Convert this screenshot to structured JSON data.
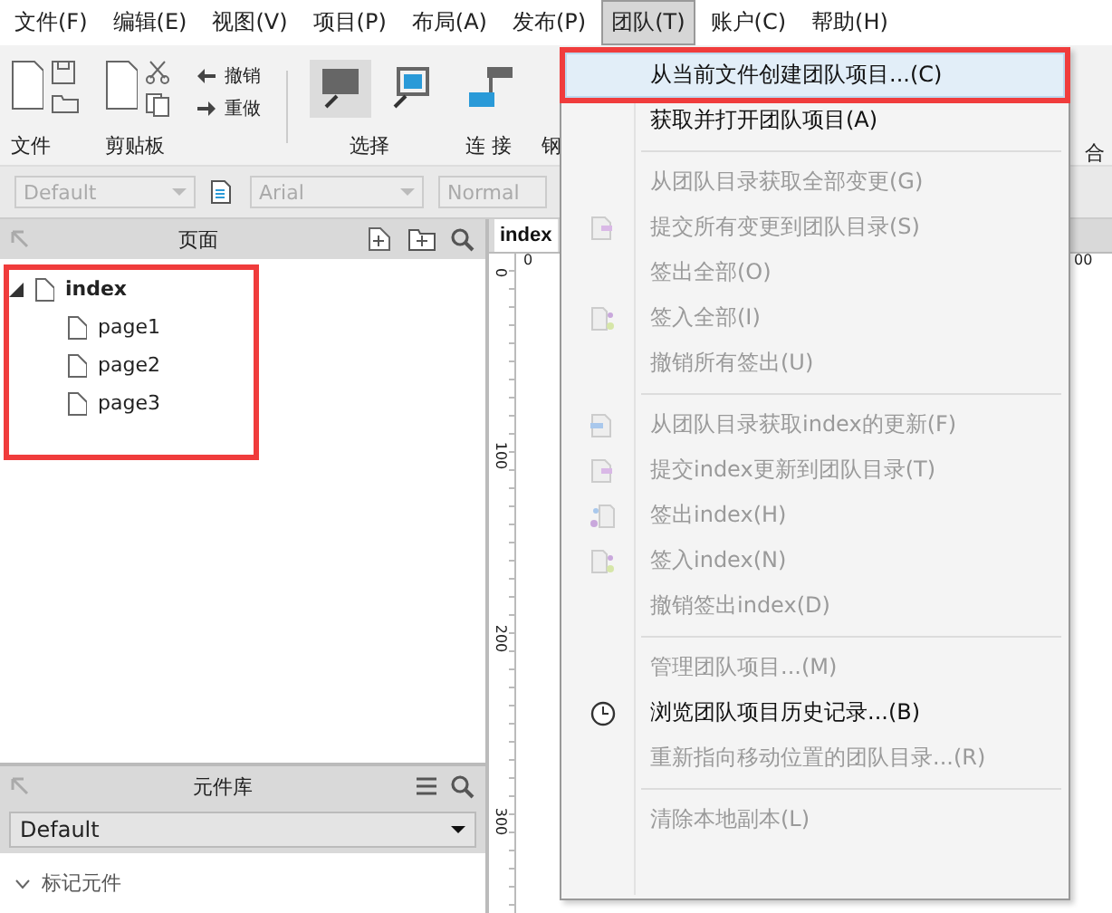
{
  "menubar": [
    {
      "label": "文件(F)",
      "selected": false
    },
    {
      "label": "编辑(E)",
      "selected": false
    },
    {
      "label": "视图(V)",
      "selected": false
    },
    {
      "label": "项目(P)",
      "selected": false
    },
    {
      "label": "布局(A)",
      "selected": false
    },
    {
      "label": "发布(P)",
      "selected": false
    },
    {
      "label": "团队(T)",
      "selected": true
    },
    {
      "label": "账户(C)",
      "selected": false
    },
    {
      "label": "帮助(H)",
      "selected": false
    }
  ],
  "toolbar": {
    "groups": [
      {
        "kind": "file",
        "label": "文件"
      },
      {
        "kind": "clipboard",
        "label": "剪贴板"
      },
      {
        "kind": "undo",
        "undo": "撤销",
        "redo": "重做"
      },
      {
        "kind": "select",
        "label": "选择"
      },
      {
        "kind": "connect",
        "label": "连 接"
      },
      {
        "kind": "pen",
        "label": "钢"
      }
    ],
    "right_label": "合"
  },
  "format_bar": {
    "style": "Default",
    "font": "Arial",
    "weight": "Normal"
  },
  "pages_panel": {
    "title": "页面",
    "annotated": true,
    "tree": [
      {
        "label": "index",
        "expanded": true,
        "children": [
          {
            "label": "page1"
          },
          {
            "label": "page2"
          },
          {
            "label": "page3"
          }
        ]
      }
    ]
  },
  "canvas": {
    "tab": "index",
    "top_ruler": [
      "0",
      "00"
    ],
    "side_ruler": [
      "0",
      "100",
      "200",
      "300"
    ]
  },
  "library_panel": {
    "title": "元件库",
    "library": "Default",
    "sections": [
      {
        "label": "标记元件",
        "expanded": true
      }
    ]
  },
  "menu": {
    "items": [
      {
        "kind": "plain",
        "label": "从当前文件创建团队项目...(C)",
        "disabled": false,
        "highlighted": true,
        "annotated": true
      },
      {
        "kind": "plain",
        "label": "获取并打开团队项目(A)",
        "disabled": false,
        "highlighted": false,
        "annotated": false
      },
      {
        "kind": "separator"
      },
      {
        "kind": "plain",
        "label": "从团队目录获取全部变更(G)",
        "disabled": true,
        "highlighted": false,
        "annotated": false
      },
      {
        "kind": "commit",
        "label": "提交所有变更到团队目录(S)",
        "disabled": true,
        "highlighted": false,
        "annotated": false
      },
      {
        "kind": "plain",
        "label": "签出全部(O)",
        "disabled": true,
        "highlighted": false,
        "annotated": false
      },
      {
        "kind": "checkin",
        "label": "签入全部(I)",
        "disabled": true,
        "highlighted": false,
        "annotated": false
      },
      {
        "kind": "plain",
        "label": "撤销所有签出(U)",
        "disabled": true,
        "highlighted": false,
        "annotated": false
      },
      {
        "kind": "separator"
      },
      {
        "kind": "update",
        "label": "从团队目录获取index的更新(F)",
        "disabled": true,
        "highlighted": false,
        "annotated": false
      },
      {
        "kind": "commit",
        "label": "提交index更新到团队目录(T)",
        "disabled": true,
        "highlighted": false,
        "annotated": false
      },
      {
        "kind": "checkout",
        "label": "签出index(H)",
        "disabled": true,
        "highlighted": false,
        "annotated": false
      },
      {
        "kind": "checkin",
        "label": "签入index(N)",
        "disabled": true,
        "highlighted": false,
        "annotated": false
      },
      {
        "kind": "plain",
        "label": "撤销签出index(D)",
        "disabled": true,
        "highlighted": false,
        "annotated": false
      },
      {
        "kind": "separator"
      },
      {
        "kind": "plain",
        "label": "管理团队项目...(M)",
        "disabled": true,
        "highlighted": false,
        "annotated": false
      },
      {
        "kind": "history",
        "label": "浏览团队项目历史记录...(B)",
        "disabled": false,
        "highlighted": false,
        "annotated": false
      },
      {
        "kind": "plain",
        "label": "重新指向移动位置的团队目录...(R)",
        "disabled": true,
        "highlighted": false,
        "annotated": false
      },
      {
        "kind": "separator"
      },
      {
        "kind": "plain",
        "label": "清除本地副本(L)",
        "disabled": true,
        "highlighted": false,
        "annotated": false
      }
    ]
  }
}
